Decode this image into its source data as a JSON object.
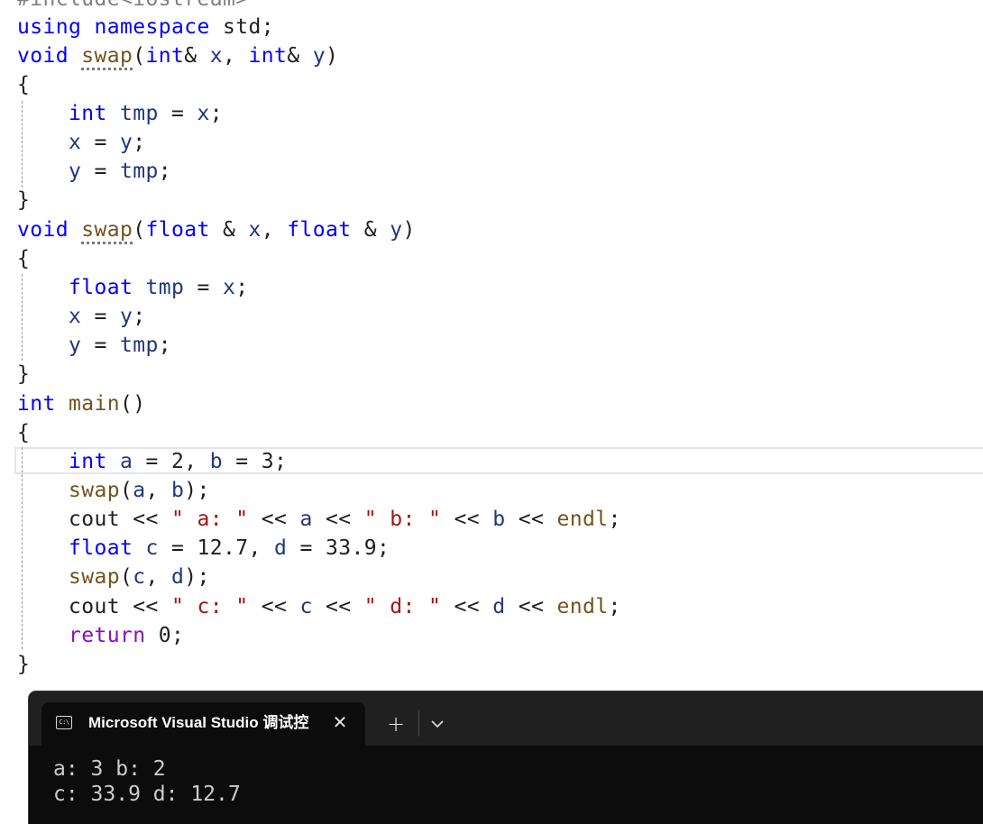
{
  "editor": {
    "include_partial": "#include<iostream>",
    "lines": {
      "using_kw": "using",
      "namespace_kw": "namespace",
      "std": "std;",
      "void": "void",
      "swap": "swap",
      "int": "int",
      "float": "float",
      "tmp": "tmp",
      "x": "x",
      "y": "y",
      "main": "main",
      "return": "return",
      "cout": "cout",
      "endl": "endl",
      "a": "a",
      "b": "b",
      "c": "c",
      "d": "d",
      "num_2": "2",
      "num_3": "3",
      "num_127": "12.7",
      "num_339": "33.9",
      "num_0": "0",
      "str_a": "\" a: \"",
      "str_b": "\" b: \"",
      "str_c": "\" c: \"",
      "str_d": "\" d: \""
    }
  },
  "console": {
    "tab_title": "Microsoft Visual Studio 调试控",
    "tab_icon_text": "C:\\",
    "close_glyph": "✕",
    "new_tab_glyph": "+",
    "output_lines": [
      "a: 3 b: 2",
      "c: 33.9 d: 12.7"
    ]
  },
  "colors": {
    "keyword": "#0000ff",
    "control_keyword": "#8f08c4",
    "function": "#74531f",
    "parameter": "#1f377f",
    "string": "#a31515",
    "console_bg": "#0c0c0c",
    "tabbar_bg": "#202020"
  }
}
